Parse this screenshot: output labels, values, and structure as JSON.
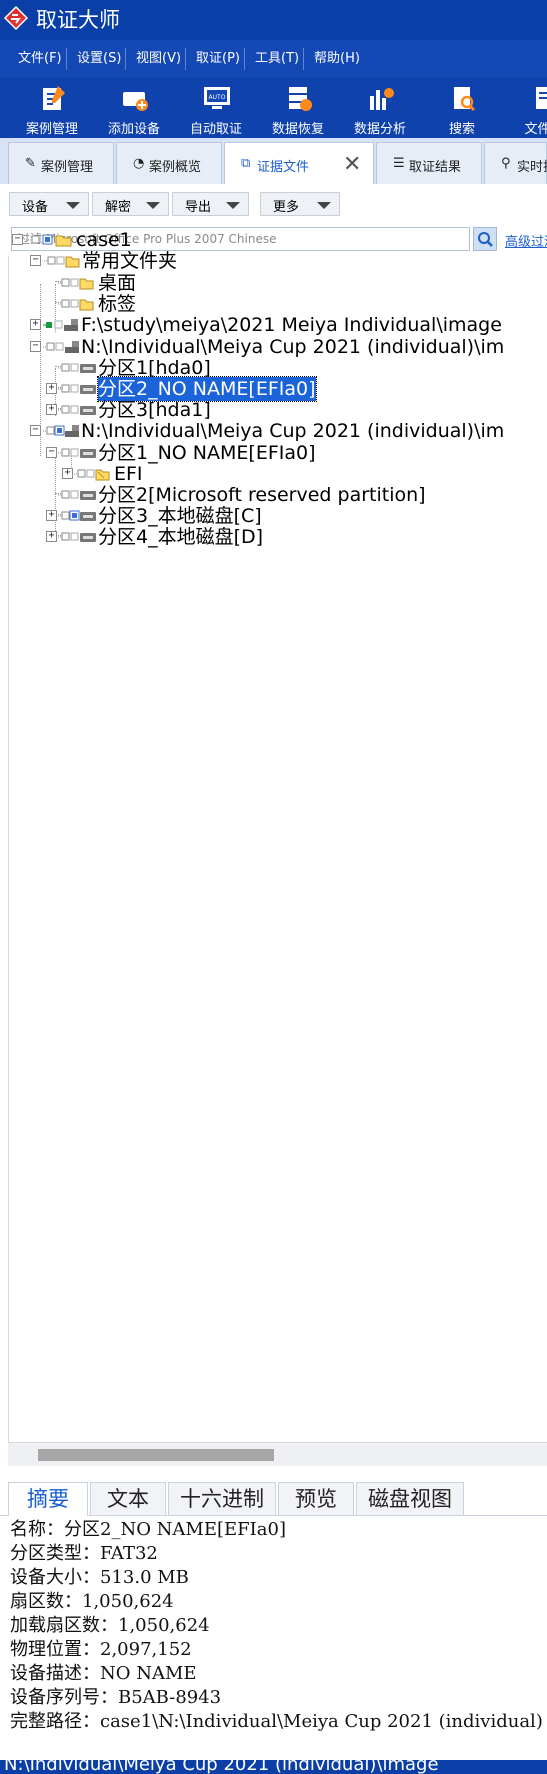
{
  "app": {
    "title": "取证大师"
  },
  "menu": [
    "文件(F)",
    "设置(S)",
    "视图(V)",
    "取证(P)",
    "工具(T)",
    "帮助(H)"
  ],
  "toolbar": [
    "案例管理",
    "添加设备",
    "自动取证",
    "数据恢复",
    "数据分析",
    "搜索",
    "文件过"
  ],
  "tabs": [
    {
      "label": "案例管理",
      "icon": "edit-icon"
    },
    {
      "label": "案例概览",
      "icon": "pie-icon"
    },
    {
      "label": "证据文件",
      "icon": "copy-icon",
      "active": true
    },
    {
      "label": "取证结果",
      "icon": "list-icon"
    },
    {
      "label": "实时排",
      "icon": "search-icon"
    }
  ],
  "filters": [
    "设备",
    "解密",
    "导出",
    "更多"
  ],
  "search": {
    "placeholder": "过滤 Microsoft Office Pro Plus 2007 Chinese",
    "advanced_label": "高级过滤"
  },
  "tree": {
    "root": "case1",
    "common_folder": "常用文件夹",
    "desktop": "桌面",
    "tags": "标签",
    "image1": "F:\\study\\meiya\\2021 Meiya Individual\\image",
    "image2": "N:\\Individual\\Meiya Cup 2021 (individual)\\im",
    "img2_p1": "分区1[hda0]",
    "img2_p2": "分区2_NO NAME[EFIa0]",
    "img2_p3": "分区3[hda1]",
    "image3": "N:\\Individual\\Meiya Cup 2021 (individual)\\im",
    "img3_p1": "分区1_NO NAME[EFIa0]",
    "img3_efi": "EFI",
    "img3_p2": "分区2[Microsoft reserved partition]",
    "img3_p3": "分区3_本地磁盘[C]",
    "img3_p4": "分区4_本地磁盘[D]"
  },
  "bottom_tabs": [
    "摘要",
    "文本",
    "十六进制",
    "预览",
    "磁盘视图"
  ],
  "details": [
    "名称：分区2_NO NAME[EFIa0]",
    "分区类型：FAT32",
    "设备大小：513.0 MB",
    "扇区数：1,050,624",
    "加载扇区数：1,050,624",
    "物理位置：2,097,152",
    "设备描述：NO NAME",
    "设备序列号：B5AB-8943",
    "完整路径：case1\\N:\\Individual\\Meiya Cup 2021 (individual)"
  ],
  "status": "N:\\Individual\\Meiya Cup 2021 (individual)\\image"
}
